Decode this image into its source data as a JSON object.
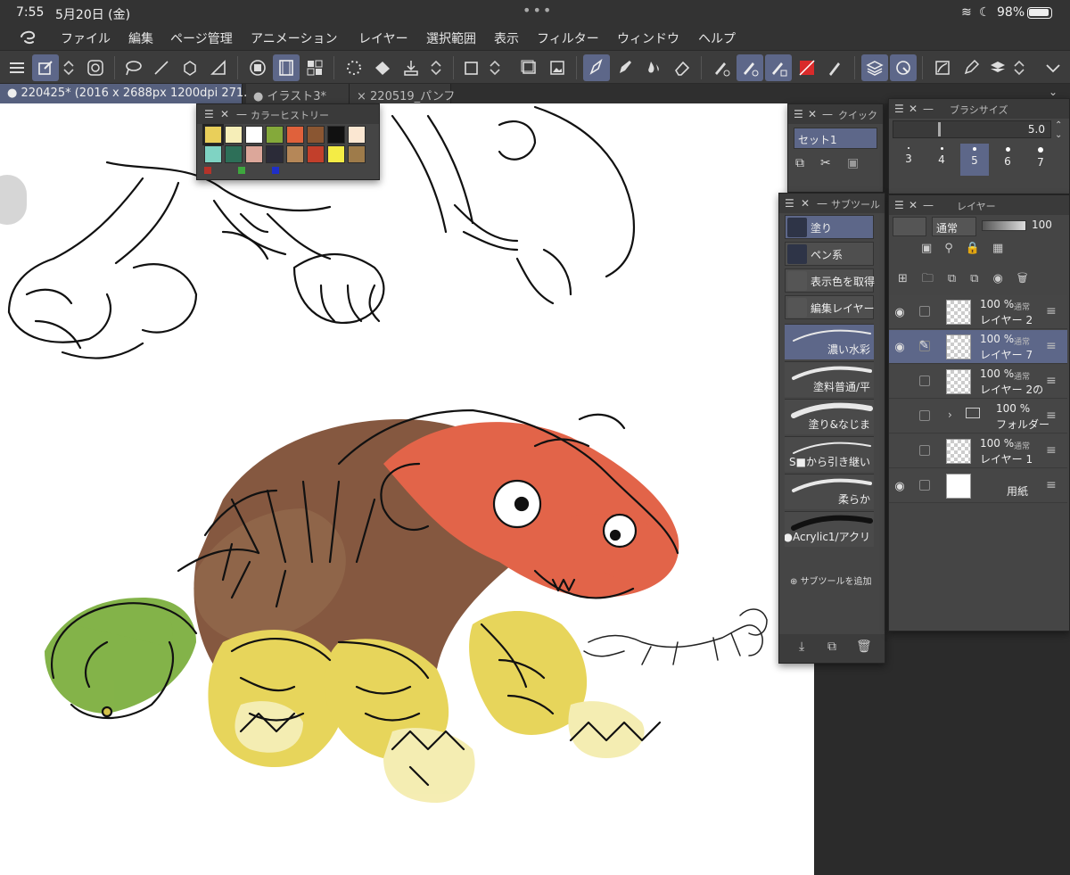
{
  "status": {
    "time": "7:55",
    "date": "5月20日 (金)",
    "battery": "98%"
  },
  "menu": [
    "ファイル",
    "編集",
    "ページ管理",
    "アニメーション",
    "レイヤー",
    "選択範囲",
    "表示",
    "フィルター",
    "ウィンドウ",
    "ヘルプ"
  ],
  "tabs": [
    "● 220425* (2016 x 2688px 1200dpi 271.9%)",
    "● イラスト3*",
    "× 220519_パンフ"
  ],
  "color_history": {
    "title": "カラーヒストリー",
    "swatches": [
      "#e9cf5a",
      "#f6eeb8",
      "#ffffff",
      "#84a93a",
      "#e0613b",
      "#8a5632",
      "#111111",
      "#fbe7d2",
      "#7fd3c3",
      "#2d6f58",
      "#dca79a",
      "#2b2b38",
      "#b58758",
      "#c23f2b",
      "#f4ec45",
      "#9e7b4a"
    ],
    "recent": [
      "#b5332a",
      "#3ea63e",
      "#1f2fc8"
    ]
  },
  "quick": {
    "title": "クイック",
    "set": "セット1"
  },
  "brush_size": {
    "title": "ブラシサイズ",
    "value": "5.0",
    "presets": [
      "3",
      "4",
      "5",
      "6",
      "7"
    ]
  },
  "subtool": {
    "title": "サブツール",
    "groups": [
      "塗り",
      "ペン系",
      "表示色を取得",
      "編集レイヤー"
    ],
    "brushes": [
      "濃い水彩",
      "塗料普通/平",
      "塗り&なじま",
      "S■から引き継い",
      "柔らか",
      "●Acrylic1/アクリ"
    ],
    "add_label": "サブツールを追加"
  },
  "layer_panel": {
    "title": "レイヤー",
    "blend_mode": "通常",
    "opacity": "100",
    "layers": [
      {
        "pct": "100 %",
        "mode": "通常",
        "name": "レイヤー 2"
      },
      {
        "pct": "100 %",
        "mode": "通常",
        "name": "レイヤー 7"
      },
      {
        "pct": "100 %",
        "mode": "通常",
        "name": "レイヤー 2の"
      },
      {
        "pct": "100 %",
        "mode": "",
        "name": "フォルダー"
      },
      {
        "pct": "100 %",
        "mode": "通常",
        "name": "レイヤー 1"
      },
      {
        "pct": "",
        "mode": "",
        "name": "用紙"
      }
    ]
  },
  "colors": {
    "accent": "#5d6789",
    "panel": "#454545",
    "canvas": "#ffffff"
  }
}
